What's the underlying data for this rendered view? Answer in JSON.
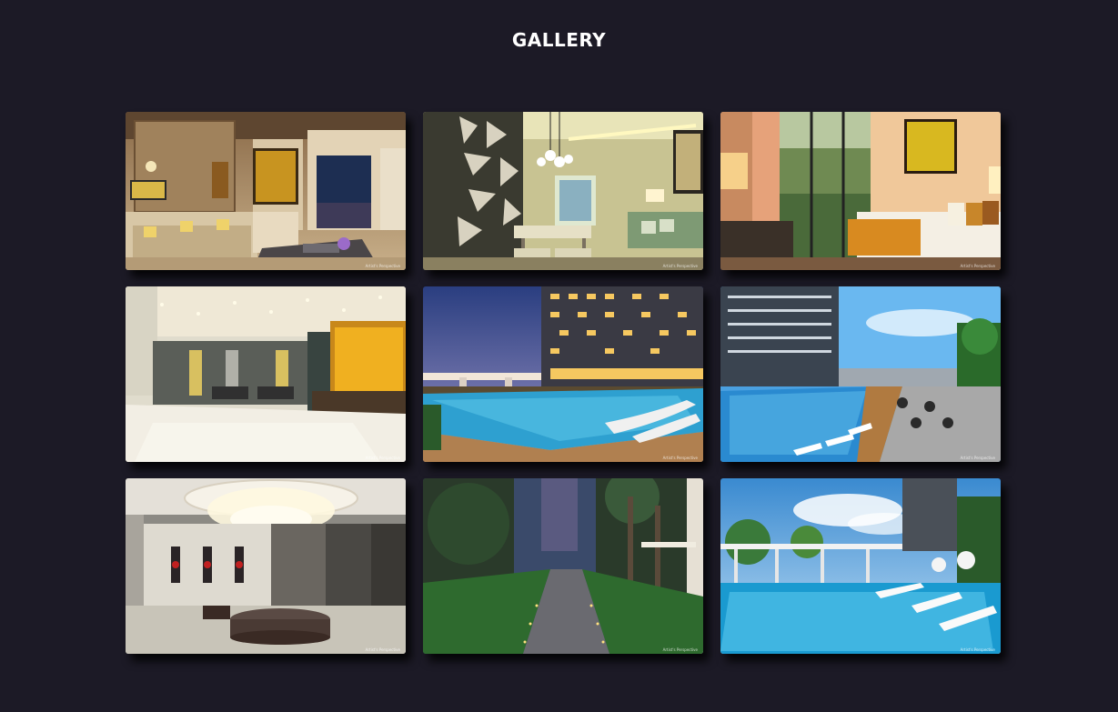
{
  "page": {
    "title": "GALLERY"
  },
  "gallery": {
    "items": [
      {
        "subject": "living room",
        "caption": "Artist's Perspective"
      },
      {
        "subject": "dining area",
        "caption": "Artist's Perspective"
      },
      {
        "subject": "bedroom",
        "caption": "Artist's Perspective"
      },
      {
        "subject": "lobby",
        "caption": "Artist's Perspective"
      },
      {
        "subject": "pool at dusk",
        "caption": "Artist's Perspective"
      },
      {
        "subject": "pool deck",
        "caption": "Artist's Perspective"
      },
      {
        "subject": "lobby with chandelier",
        "caption": "Artist's Perspective"
      },
      {
        "subject": "garden walkway",
        "caption": "Artist's Perspective"
      },
      {
        "subject": "pool with cabanas",
        "caption": "Artist's Perspective"
      }
    ]
  }
}
